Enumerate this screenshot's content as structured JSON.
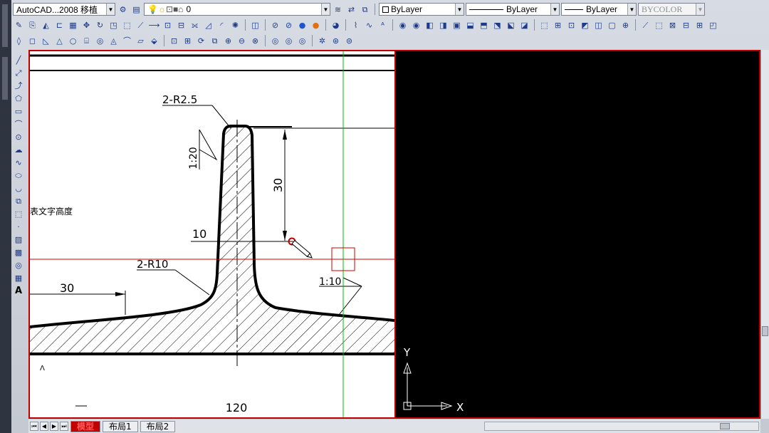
{
  "toolbar1": {
    "workspace": "AutoCAD...2008 移植",
    "layer": "0",
    "color": "ByLayer",
    "linetype": "ByLayer",
    "lineweight": "ByLayer",
    "plotstyle": "BYCOLOR"
  },
  "tabs": {
    "model": "模型",
    "layout1": "布局1",
    "layout2": "布局2"
  },
  "side_label": "表文字高度",
  "drawing": {
    "dim_r25": "2-R2.5",
    "dim_slope_left": "1:20",
    "dim_30_vertical": "30",
    "dim_10": "10",
    "dim_r10": "2-R10",
    "dim_30_horizontal": "30",
    "dim_slope_right": "1:10",
    "dim_120": "120"
  },
  "ucs": {
    "y_label": "Y",
    "x_label": "X"
  },
  "colors": {
    "frame": "#c00000",
    "crosshair_h": "#d00000",
    "crosshair_v": "#00c000",
    "background": "#000000",
    "paper": "#ffffff"
  }
}
